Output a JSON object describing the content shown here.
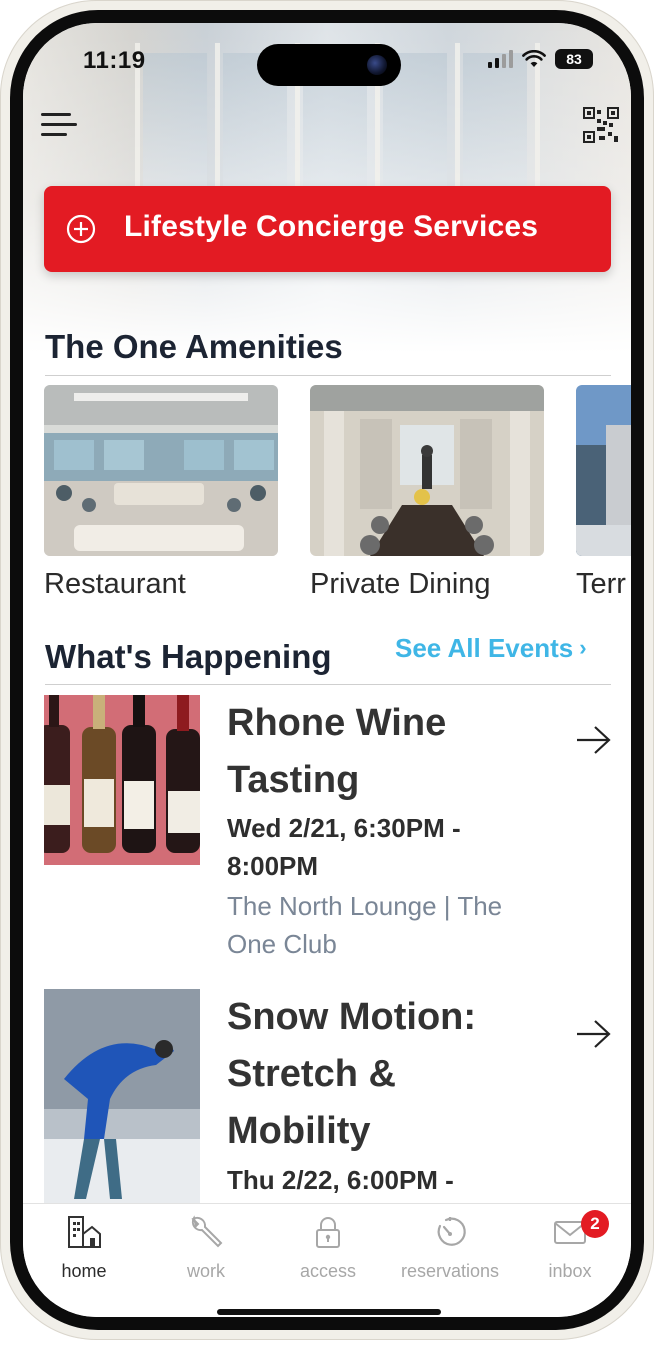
{
  "status_bar": {
    "time": "11:19",
    "battery": "83"
  },
  "cta": {
    "label": "Lifestyle Concierge Services"
  },
  "amenities": {
    "title": "The One Amenities",
    "items": [
      {
        "label": "Restaurant"
      },
      {
        "label": "Private Dining"
      },
      {
        "label": "Terr"
      }
    ]
  },
  "events": {
    "title": "What's Happening",
    "see_all": "See All Events",
    "items": [
      {
        "title": "Rhone Wine Tasting",
        "date": "Wed 2/21, 6:30PM - 8:00PM",
        "location": "The North Lounge | The One Club"
      },
      {
        "title": "Snow Motion: Stretch & Mobility",
        "date": "Thu 2/22, 6:00PM -"
      }
    ]
  },
  "tabbar": {
    "items": [
      {
        "label": "home",
        "icon": "home-building-icon"
      },
      {
        "label": "work",
        "icon": "wrench-icon"
      },
      {
        "label": "access",
        "icon": "lock-icon"
      },
      {
        "label": "reservations",
        "icon": "timer-icon"
      },
      {
        "label": "inbox",
        "icon": "envelope-icon",
        "badge": "2"
      }
    ]
  },
  "colors": {
    "accent_red": "#e31b23",
    "link_blue": "#3fb6e6",
    "heading_navy": "#1c2433"
  }
}
